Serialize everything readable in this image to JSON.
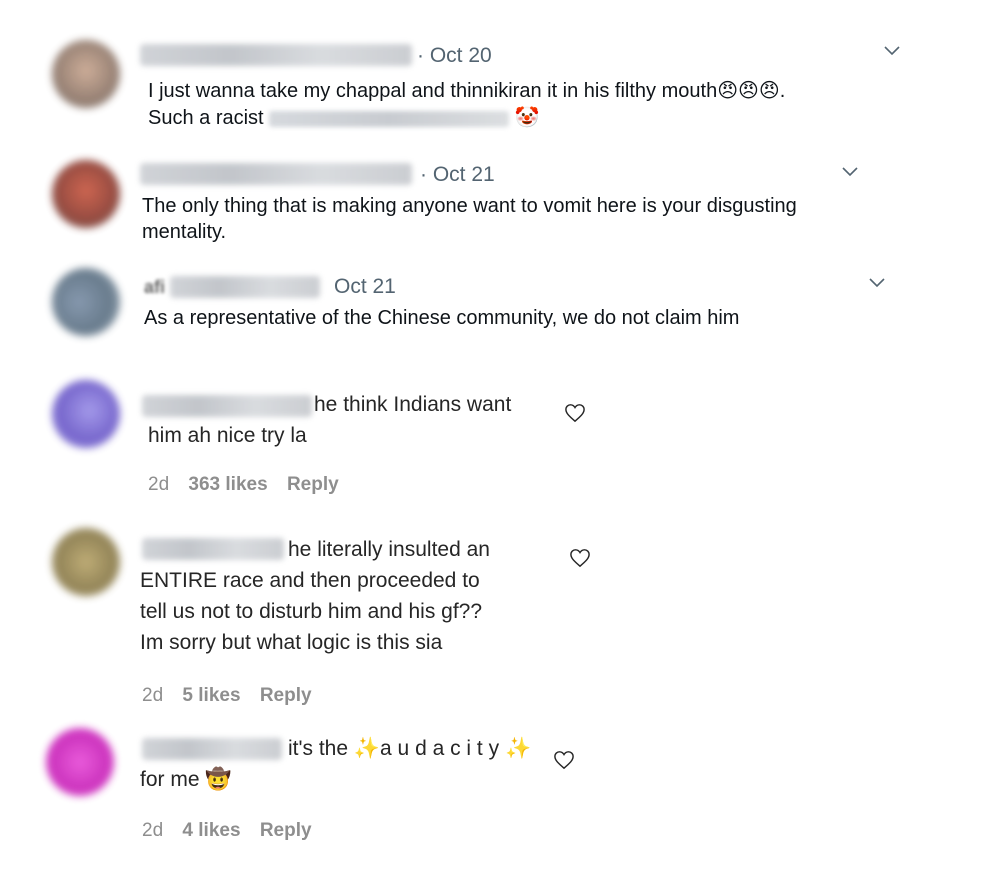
{
  "twitter_replies": [
    {
      "date": "· Oct 20",
      "line1": "I just wanna take my chappal and thinnikiran it in his filthy mouth",
      "line1_emoji": "😠😠😠",
      "line1_end": ".",
      "line2_start": "Such a racist",
      "line2_emoji": "🤡"
    },
    {
      "date": "· Oct 21",
      "line1": "The only thing that is making anyone want to vomit here is your disgusting",
      "line2": "mentality."
    },
    {
      "prefix": "afi",
      "date": "Oct 21",
      "line1": "As a representative of the Chinese community, we do not claim him"
    }
  ],
  "instagram_comments": [
    {
      "lines": [
        "he think Indians want",
        "him ah nice try la"
      ],
      "time": "2d",
      "likes": "363 likes",
      "reply": "Reply"
    },
    {
      "lines": [
        "he literally insulted an",
        "ENTIRE race and then proceeded to",
        "tell us not to disturb him and his gf??",
        "Im sorry but what logic is this sia"
      ],
      "time": "2d",
      "likes": "5 likes",
      "reply": "Reply"
    },
    {
      "line1_a": "it's the",
      "sparkle": "✨",
      "line1_b": "a u d a c i t y",
      "line2": "for me",
      "line2_emoji": "🤠",
      "time": "2d",
      "likes": "4 likes",
      "reply": "Reply"
    }
  ],
  "icons": {
    "caret": "chevron-down-icon",
    "heart": "heart-outline-icon"
  }
}
